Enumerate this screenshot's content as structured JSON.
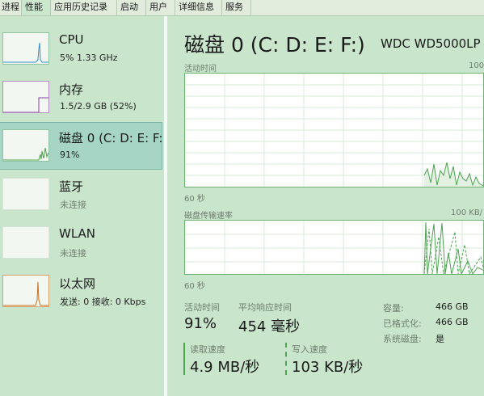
{
  "tabs": [
    {
      "label": "进程"
    },
    {
      "label": "性能"
    },
    {
      "label": "应用历史记录"
    },
    {
      "label": "启动"
    },
    {
      "label": "用户"
    },
    {
      "label": "详细信息"
    },
    {
      "label": "服务"
    }
  ],
  "sidebar": {
    "items": [
      {
        "title": "CPU",
        "subtitle": "5% 1.33 GHz"
      },
      {
        "title": "内存",
        "subtitle": "1.5/2.9 GB (52%)"
      },
      {
        "title": "磁盘 0 (C: D: E: F:",
        "subtitle": "91%"
      },
      {
        "title": "蓝牙",
        "subtitle": "未连接"
      },
      {
        "title": "WLAN",
        "subtitle": "未连接"
      },
      {
        "title": "以太网",
        "subtitle": "发送: 0 接收: 0 Kbps"
      }
    ]
  },
  "main": {
    "title": "磁盘 0 (C: D: E: F:)",
    "model": "WDC WD5000LP",
    "graph1": {
      "label": "活动时间",
      "max": "100",
      "time": "60 秒"
    },
    "graph2": {
      "label": "磁盘传输速率",
      "max": "100 KB/",
      "time": "60 秒"
    },
    "stats": {
      "active_label": "活动时间",
      "active_value": "91%",
      "resp_label": "平均响应时间",
      "resp_value": "454 毫秒",
      "read_label": "读取速度",
      "read_value": "4.9 MB/秒",
      "write_label": "写入速度",
      "write_value": "103 KB/秒"
    },
    "props": [
      {
        "label": "容量:",
        "value": "466 GB"
      },
      {
        "label": "已格式化:",
        "value": "466 GB"
      },
      {
        "label": "系统磁盘:",
        "value": "是"
      }
    ]
  },
  "colors": {
    "accent": "#4ca34f",
    "memory": "#8b3fa8",
    "ethernet": "#c7711d",
    "selected": "#a6d5c6"
  }
}
